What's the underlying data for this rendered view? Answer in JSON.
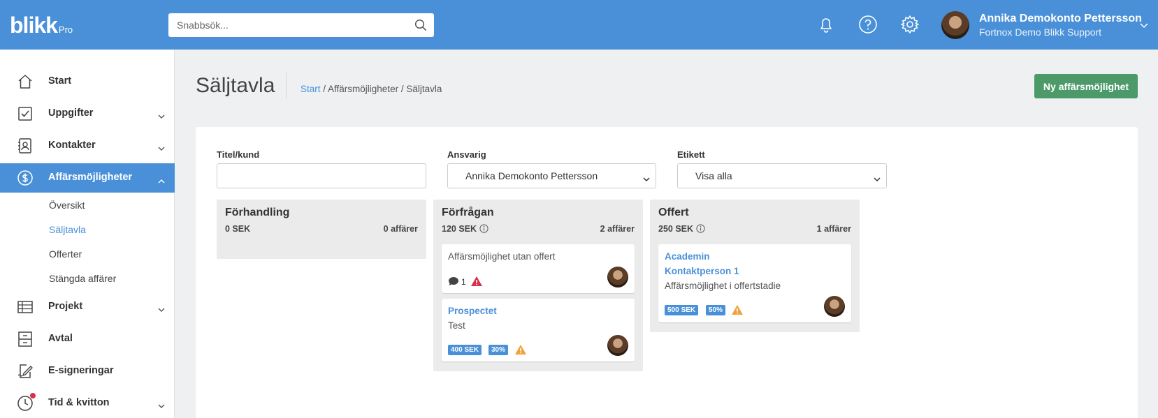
{
  "app": {
    "logo_text": "blikk",
    "logo_suffix": "Pro"
  },
  "topbar": {
    "search_placeholder": "Snabbsök...",
    "user_name": "Annika Demokonto Pettersson",
    "user_company": "Fortnox Demo Blikk Support"
  },
  "sidebar": {
    "items": [
      {
        "label": "Start",
        "icon": "home-icon"
      },
      {
        "label": "Uppgifter",
        "icon": "checkbox-icon"
      },
      {
        "label": "Kontakter",
        "icon": "contact-icon"
      },
      {
        "label": "Affärsmöjligheter",
        "icon": "dollar-icon"
      },
      {
        "label": "Projekt",
        "icon": "table-icon"
      },
      {
        "label": "Avtal",
        "icon": "cabinet-icon"
      },
      {
        "label": "E-signeringar",
        "icon": "signature-icon"
      },
      {
        "label": "Tid & kvitton",
        "icon": "clock-icon"
      }
    ],
    "subitems": [
      {
        "label": "Översikt"
      },
      {
        "label": "Säljtavla"
      },
      {
        "label": "Offerter"
      },
      {
        "label": "Stängda affärer"
      }
    ]
  },
  "page": {
    "title": "Säljtavla",
    "breadcrumb_link": "Start",
    "breadcrumb_rest": " / Affärsmöjligheter / Säljtavla",
    "new_button": "Ny affärsmöjlighet"
  },
  "filters": {
    "title_label": "Titel/kund",
    "title_value": "",
    "owner_label": "Ansvarig",
    "owner_value": "Annika Demokonto Pettersson",
    "tag_label": "Etikett",
    "tag_value": "Visa alla"
  },
  "columns": [
    {
      "title": "Förhandling",
      "amount": "0 SEK",
      "count": "0 affärer"
    },
    {
      "title": "Förfrågan",
      "amount": "120 SEK",
      "count": "2 affärer",
      "cards": [
        {
          "text": "Affärsmöjlighet utan offert",
          "comments": "1"
        },
        {
          "title": "Prospectet",
          "text": "Test",
          "amount_tag": "400 SEK",
          "percent_tag": "30%"
        }
      ]
    },
    {
      "title": "Offert",
      "amount": "250 SEK",
      "count": "1 affärer",
      "cards": [
        {
          "title": "Academin",
          "subtitle": "Kontaktperson 1",
          "text": "Affärsmöjlighet i offertstadie",
          "amount_tag": "500 SEK",
          "percent_tag": "50%"
        }
      ]
    }
  ],
  "colors": {
    "brand_blue": "#4a90d9",
    "button_green": "#4c9a6a",
    "warning_red": "#d9304a",
    "warning_orange": "#f0a23b"
  }
}
